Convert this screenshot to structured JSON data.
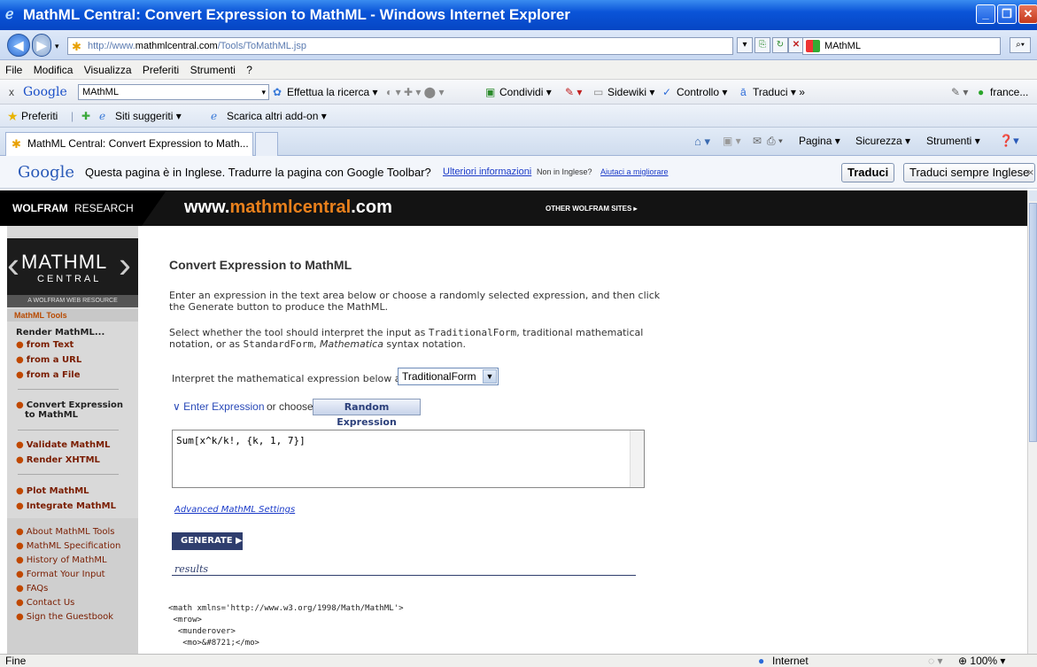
{
  "window": {
    "title": "MathML Central: Convert Expression to MathML - Windows Internet Explorer"
  },
  "address": {
    "url_prefix": "http://www.",
    "url_domain": "mathmlcentral.com",
    "url_path": "/Tools/ToMathML.jsp",
    "search_value": "MAthML"
  },
  "menu": [
    "File",
    "Modifica",
    "Visualizza",
    "Preferiti",
    "Strumenti",
    "?"
  ],
  "google_toolbar": {
    "close": "x",
    "brand": "Google",
    "query": "MAthML",
    "search_label": "Effettua la ricerca",
    "share": "Condividi",
    "sidewiki": "Sidewiki",
    "check": "Controllo",
    "translate": "Traduci",
    "more": "»",
    "user": "france..."
  },
  "favorites": {
    "label": "Preferiti",
    "suggested": "Siti suggeriti",
    "addons": "Scarica altri add-on"
  },
  "tab": {
    "title": "MathML Central: Convert Expression to Math...",
    "page": "Pagina",
    "security": "Sicurezza",
    "tools": "Strumenti"
  },
  "translate_bar": {
    "brand": "Google",
    "message": "Questa pagina è in Inglese. Tradurre la pagina con Google Toolbar?",
    "more_info": "Ulteriori informazioni",
    "not_english": "Non in Inglese?",
    "help": "Aiutaci a migliorare",
    "translate_btn": "Traduci",
    "always_btn": "Traduci sempre Inglese",
    "close": "×"
  },
  "header": {
    "wolfram_bold": "WOLFRAM",
    "wolfram_light": "RESEARCH",
    "site_prefix": "www.",
    "site_main": "mathmlcentral",
    "site_suffix": ".com",
    "other_sites": "OTHER WOLFRAM SITES ▸"
  },
  "sidebar": {
    "logo_top": "MATHML",
    "logo_bottom": "CENTRAL",
    "resource": "A WOLFRAM WEB RESOURCE",
    "section": "MathML Tools",
    "render": "Render MathML...",
    "render_links": [
      "from Text",
      "from a URL",
      "from a File"
    ],
    "convert": [
      "Convert Expression",
      "to MathML"
    ],
    "validate": "Validate MathML",
    "xhtml": "Render XHTML",
    "plot": "Plot MathML",
    "integrate": "Integrate MathML",
    "info_links": [
      "About MathML Tools",
      "MathML Specification",
      "History of MathML",
      "Format Your Input",
      "FAQs",
      "Contact Us",
      "Sign the Guestbook"
    ]
  },
  "main": {
    "heading": "Convert Expression to MathML",
    "intro1": "Enter an expression in the text area below or choose a randomly selected expression, and then click",
    "intro2": "the Generate button to produce the MathML.",
    "select1a": "Select whether the tool should interpret the input as ",
    "select1b": "TraditionalForm",
    "select1c": ", traditional mathematical",
    "select2a": "notation, or as ",
    "select2b": "StandardForm",
    "select2c": ", ",
    "select2d": "Mathematica",
    "select2e": " syntax notation.",
    "interpret_label": "Interpret the mathematical expression below as",
    "interpret_value": "TraditionalForm",
    "enter_expr": "Enter Expression",
    "or_choose": "or choose",
    "random_btn": "Random Expression",
    "expression": "Sum[x^k/k!, {k, 1, 7}]",
    "advanced": "Advanced MathML Settings",
    "generate": "GENERATE",
    "results": "results",
    "output": [
      "<math xmlns='http://www.w3.org/1998/Math/MathML'>",
      " <mrow>",
      "  <munderover>",
      "   <mo>&#8721;</mo>"
    ]
  },
  "status": {
    "left": "Fine",
    "zone": "Internet",
    "zoom": "100%"
  }
}
